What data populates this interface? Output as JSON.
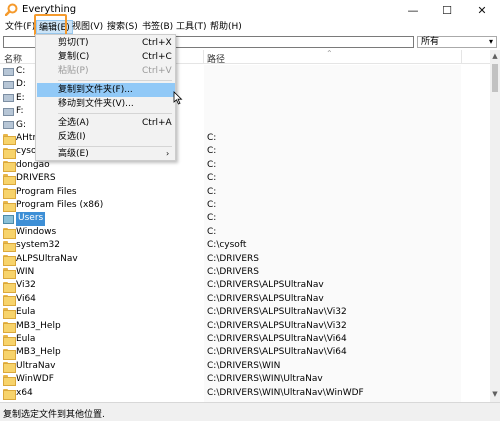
{
  "window": {
    "title": "Everything",
    "minimize_glyph": "—",
    "maximize_glyph": "☐",
    "close_glyph": "✕",
    "app_icon": "magnifier-icon",
    "accent_color": "#f59a2c"
  },
  "menubar": {
    "items": [
      "文件(F)",
      "编辑(E)",
      "视图(V)",
      "搜索(S)",
      "书签(B)",
      "工具(T)",
      "帮助(H)"
    ],
    "active_index": 1
  },
  "search": {
    "value": "",
    "filter": "所有"
  },
  "columns": {
    "name": "名称",
    "path": "路径"
  },
  "rows": [
    {
      "name": "C:",
      "path": "",
      "icon": "drive-icon"
    },
    {
      "name": "D:",
      "path": "",
      "icon": "drive-icon"
    },
    {
      "name": "E:",
      "path": "",
      "icon": "drive-icon"
    },
    {
      "name": "F:",
      "path": "",
      "icon": "drive-icon"
    },
    {
      "name": "G:",
      "path": "",
      "icon": "drive-icon"
    },
    {
      "name": "AHtm",
      "path": "C:",
      "icon": "folder-icon"
    },
    {
      "name": "cysof",
      "path": "C:",
      "icon": "folder-icon"
    },
    {
      "name": "dongao",
      "path": "C:",
      "icon": "folder-icon"
    },
    {
      "name": "DRIVERS",
      "path": "C:",
      "icon": "folder-icon"
    },
    {
      "name": "Program Files",
      "path": "C:",
      "icon": "folder-icon"
    },
    {
      "name": "Program Files (x86)",
      "path": "C:",
      "icon": "folder-icon"
    },
    {
      "name": "Users",
      "path": "C:",
      "icon": "user-icon",
      "selected": true
    },
    {
      "name": "Windows",
      "path": "C:",
      "icon": "folder-icon"
    },
    {
      "name": "system32",
      "path": "C:\\cysoft",
      "icon": "folder-icon"
    },
    {
      "name": "ALPSUltraNav",
      "path": "C:\\DRIVERS",
      "icon": "folder-icon"
    },
    {
      "name": "WIN",
      "path": "C:\\DRIVERS",
      "icon": "folder-icon"
    },
    {
      "name": "Vi32",
      "path": "C:\\DRIVERS\\ALPSUltraNav",
      "icon": "folder-icon"
    },
    {
      "name": "Vi64",
      "path": "C:\\DRIVERS\\ALPSUltraNav",
      "icon": "folder-icon"
    },
    {
      "name": "Eula",
      "path": "C:\\DRIVERS\\ALPSUltraNav\\Vi32",
      "icon": "folder-icon"
    },
    {
      "name": "MB3_Help",
      "path": "C:\\DRIVERS\\ALPSUltraNav\\Vi32",
      "icon": "folder-icon"
    },
    {
      "name": "Eula",
      "path": "C:\\DRIVERS\\ALPSUltraNav\\Vi64",
      "icon": "folder-icon"
    },
    {
      "name": "MB3_Help",
      "path": "C:\\DRIVERS\\ALPSUltraNav\\Vi64",
      "icon": "folder-icon"
    },
    {
      "name": "UltraNav",
      "path": "C:\\DRIVERS\\WIN",
      "icon": "folder-icon"
    },
    {
      "name": "WinWDF",
      "path": "C:\\DRIVERS\\WIN\\UltraNav",
      "icon": "folder-icon"
    },
    {
      "name": "x64",
      "path": "C:\\DRIVERS\\WIN\\UltraNav\\WinWDF",
      "icon": "folder-icon"
    }
  ],
  "edit_menu": {
    "items": [
      {
        "label": "剪切(T)",
        "shortcut": "Ctrl+X",
        "disabled": false
      },
      {
        "label": "复制(C)",
        "shortcut": "Ctrl+C",
        "disabled": false
      },
      {
        "label": "粘贴(P)",
        "shortcut": "Ctrl+V",
        "disabled": true
      },
      {
        "label": "复制到文件夹(F)...",
        "shortcut": "",
        "disabled": false,
        "highlight": true
      },
      {
        "label": "移动到文件夹(V)...",
        "shortcut": "",
        "disabled": false
      },
      {
        "label": "全选(A)",
        "shortcut": "Ctrl+A",
        "disabled": false
      },
      {
        "label": "反选(I)",
        "shortcut": "",
        "disabled": false
      },
      {
        "label": "高级(E)",
        "shortcut": "",
        "disabled": false,
        "submenu": true
      }
    ],
    "submenu_arrow": "›"
  },
  "statusbar": {
    "text": "复制选定文件到其他位置."
  }
}
